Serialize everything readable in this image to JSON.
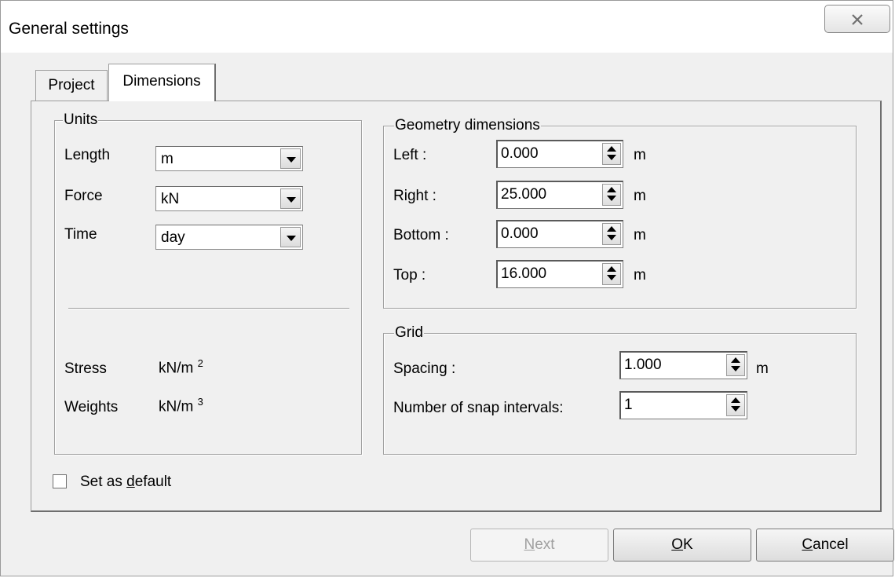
{
  "window": {
    "title": "General settings"
  },
  "tabs": [
    {
      "label": "Project",
      "active": false
    },
    {
      "label": "Dimensions",
      "active": true
    }
  ],
  "units": {
    "legend": "Units",
    "length": {
      "label": "Length",
      "value": "m"
    },
    "force": {
      "label": "Force",
      "value": "kN"
    },
    "time": {
      "label": "Time",
      "value": "day"
    },
    "stress": {
      "label": "Stress",
      "value": "kN/m",
      "exp": "2"
    },
    "weights": {
      "label": "Weights",
      "value": "kN/m",
      "exp": "3"
    }
  },
  "geometry": {
    "legend": "Geometry dimensions",
    "left": {
      "label": "Left :",
      "value": "0.000",
      "unit": "m"
    },
    "right": {
      "label": "Right :",
      "value": "25.000",
      "unit": "m"
    },
    "bottom": {
      "label": "Bottom :",
      "value": "0.000",
      "unit": "m"
    },
    "top": {
      "label": "Top :",
      "value": "16.000",
      "unit": "m"
    }
  },
  "grid": {
    "legend": "Grid",
    "spacing": {
      "label": "Spacing :",
      "value": "1.000",
      "unit": "m"
    },
    "snap": {
      "label": "Number of snap intervals:",
      "value": "1"
    }
  },
  "default_checkbox": {
    "label_pre": "Set as ",
    "label_mnemonic": "d",
    "label_post": "efault",
    "checked": false
  },
  "buttons": {
    "next": {
      "mnemonic": "N",
      "rest": "ext",
      "enabled": false
    },
    "ok": {
      "mnemonic": "O",
      "rest": "K"
    },
    "cancel": {
      "mnemonic": "C",
      "rest": "ancel"
    }
  }
}
